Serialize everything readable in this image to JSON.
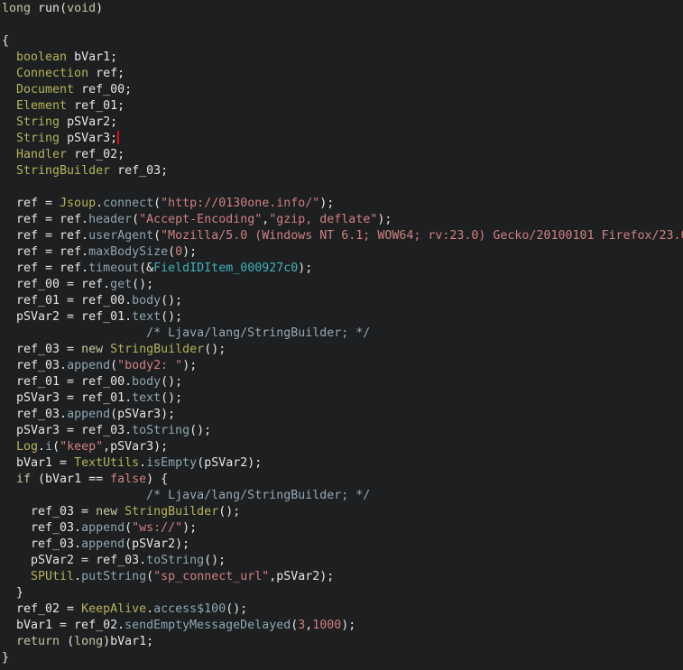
{
  "colors": {
    "background": "#1d1f21",
    "plain": "#e6e6e6",
    "keyword": "#c9c6a0",
    "type": "#b5b35a",
    "function": "#8fa6b2",
    "string": "#d08080",
    "number": "#d08080",
    "comment": "#98a8b6",
    "field": "#40b2b8",
    "caret": "#e0101a"
  },
  "editor": {
    "caret_line": 9,
    "lines": [
      [
        [
          "kw",
          "long "
        ],
        [
          "plain",
          "run"
        ],
        [
          "paren",
          "("
        ],
        [
          "kw",
          "void"
        ],
        [
          "paren",
          ")"
        ]
      ],
      [],
      [
        [
          "plain",
          "{"
        ]
      ],
      [
        [
          "plain",
          "  "
        ],
        [
          "type",
          "boolean"
        ],
        [
          "plain",
          " bVar1;"
        ]
      ],
      [
        [
          "plain",
          "  "
        ],
        [
          "type",
          "Connection"
        ],
        [
          "plain",
          " ref;"
        ]
      ],
      [
        [
          "plain",
          "  "
        ],
        [
          "type",
          "Document"
        ],
        [
          "plain",
          " ref_00;"
        ]
      ],
      [
        [
          "plain",
          "  "
        ],
        [
          "type",
          "Element"
        ],
        [
          "plain",
          " ref_01;"
        ]
      ],
      [
        [
          "plain",
          "  "
        ],
        [
          "type",
          "String"
        ],
        [
          "plain",
          " pSVar2;"
        ]
      ],
      [
        [
          "plain",
          "  "
        ],
        [
          "type",
          "String"
        ],
        [
          "plain",
          " pSVar3;"
        ]
      ],
      [
        [
          "plain",
          "  "
        ],
        [
          "type",
          "Handler"
        ],
        [
          "plain",
          " ref_02;"
        ]
      ],
      [
        [
          "plain",
          "  "
        ],
        [
          "type",
          "StringBuilder"
        ],
        [
          "plain",
          " ref_03;"
        ]
      ],
      [],
      [
        [
          "plain",
          "  ref = "
        ],
        [
          "type",
          "Jsoup"
        ],
        [
          "plain",
          "."
        ],
        [
          "fn",
          "connect"
        ],
        [
          "plain",
          "("
        ],
        [
          "str",
          "\"http://0130one.info/\""
        ],
        [
          "plain",
          ");"
        ]
      ],
      [
        [
          "plain",
          "  ref = ref."
        ],
        [
          "fn",
          "header"
        ],
        [
          "plain",
          "("
        ],
        [
          "str",
          "\"Accept-Encoding\""
        ],
        [
          "plain",
          ","
        ],
        [
          "str",
          "\"gzip, deflate\""
        ],
        [
          "plain",
          ");"
        ]
      ],
      [
        [
          "plain",
          "  ref = ref."
        ],
        [
          "fn",
          "userAgent"
        ],
        [
          "plain",
          "("
        ],
        [
          "str",
          "\"Mozilla/5.0 (Windows NT 6.1; WOW64; rv:23.0) Gecko/20100101 Firefox/23.0\""
        ],
        [
          "plain",
          ");"
        ]
      ],
      [
        [
          "plain",
          "  ref = ref."
        ],
        [
          "fn",
          "maxBodySize"
        ],
        [
          "plain",
          "("
        ],
        [
          "num",
          "0"
        ],
        [
          "plain",
          ");"
        ]
      ],
      [
        [
          "plain",
          "  ref = ref."
        ],
        [
          "fn",
          "timeout"
        ],
        [
          "plain",
          "(&"
        ],
        [
          "field",
          "FieldIDItem_000927c0"
        ],
        [
          "plain",
          ");"
        ]
      ],
      [
        [
          "plain",
          "  ref_00 = ref."
        ],
        [
          "fn",
          "get"
        ],
        [
          "plain",
          "();"
        ]
      ],
      [
        [
          "plain",
          "  ref_01 = ref_00."
        ],
        [
          "fn",
          "body"
        ],
        [
          "plain",
          "();"
        ]
      ],
      [
        [
          "plain",
          "  pSVar2 = ref_01."
        ],
        [
          "fn",
          "text"
        ],
        [
          "plain",
          "();"
        ]
      ],
      [
        [
          "plain",
          "                    "
        ],
        [
          "comment",
          "/* Ljava/lang/StringBuilder; */"
        ]
      ],
      [
        [
          "plain",
          "  ref_03 = "
        ],
        [
          "kw",
          "new"
        ],
        [
          "plain",
          " "
        ],
        [
          "type",
          "StringBuilder"
        ],
        [
          "plain",
          "();"
        ]
      ],
      [
        [
          "plain",
          "  ref_03."
        ],
        [
          "fn",
          "append"
        ],
        [
          "plain",
          "("
        ],
        [
          "str",
          "\"body2: \""
        ],
        [
          "plain",
          ");"
        ]
      ],
      [
        [
          "plain",
          "  ref_01 = ref_00."
        ],
        [
          "fn",
          "body"
        ],
        [
          "plain",
          "();"
        ]
      ],
      [
        [
          "plain",
          "  pSVar3 = ref_01."
        ],
        [
          "fn",
          "text"
        ],
        [
          "plain",
          "();"
        ]
      ],
      [
        [
          "plain",
          "  ref_03."
        ],
        [
          "fn",
          "append"
        ],
        [
          "plain",
          "(pSVar3);"
        ]
      ],
      [
        [
          "plain",
          "  pSVar3 = ref_03."
        ],
        [
          "fn",
          "toString"
        ],
        [
          "plain",
          "();"
        ]
      ],
      [
        [
          "plain",
          "  "
        ],
        [
          "type",
          "Log"
        ],
        [
          "plain",
          "."
        ],
        [
          "fn",
          "i"
        ],
        [
          "plain",
          "("
        ],
        [
          "str",
          "\"keep\""
        ],
        [
          "plain",
          ",pSVar3);"
        ]
      ],
      [
        [
          "plain",
          "  bVar1 = "
        ],
        [
          "type",
          "TextUtils"
        ],
        [
          "plain",
          "."
        ],
        [
          "fn",
          "isEmpty"
        ],
        [
          "plain",
          "(pSVar2);"
        ]
      ],
      [
        [
          "plain",
          "  "
        ],
        [
          "kw",
          "if"
        ],
        [
          "plain",
          " (bVar1 == "
        ],
        [
          "num",
          "false"
        ],
        [
          "plain",
          ") {"
        ]
      ],
      [
        [
          "plain",
          "                    "
        ],
        [
          "comment",
          "/* Ljava/lang/StringBuilder; */"
        ]
      ],
      [
        [
          "plain",
          "    ref_03 = "
        ],
        [
          "kw",
          "new"
        ],
        [
          "plain",
          " "
        ],
        [
          "type",
          "StringBuilder"
        ],
        [
          "plain",
          "();"
        ]
      ],
      [
        [
          "plain",
          "    ref_03."
        ],
        [
          "fn",
          "append"
        ],
        [
          "plain",
          "("
        ],
        [
          "str",
          "\"ws://\""
        ],
        [
          "plain",
          ");"
        ]
      ],
      [
        [
          "plain",
          "    ref_03."
        ],
        [
          "fn",
          "append"
        ],
        [
          "plain",
          "(pSVar2);"
        ]
      ],
      [
        [
          "plain",
          "    pSVar2 = ref_03."
        ],
        [
          "fn",
          "toString"
        ],
        [
          "plain",
          "();"
        ]
      ],
      [
        [
          "plain",
          "    "
        ],
        [
          "type",
          "SPUtil"
        ],
        [
          "plain",
          "."
        ],
        [
          "fn",
          "putString"
        ],
        [
          "plain",
          "("
        ],
        [
          "str",
          "\"sp_connect_url\""
        ],
        [
          "plain",
          ",pSVar2);"
        ]
      ],
      [
        [
          "plain",
          "  }"
        ]
      ],
      [
        [
          "plain",
          "  ref_02 = "
        ],
        [
          "type",
          "KeepAlive"
        ],
        [
          "plain",
          "."
        ],
        [
          "fn",
          "access$100"
        ],
        [
          "plain",
          "();"
        ]
      ],
      [
        [
          "plain",
          "  bVar1 = ref_02."
        ],
        [
          "fn",
          "sendEmptyMessageDelayed"
        ],
        [
          "plain",
          "("
        ],
        [
          "num",
          "3"
        ],
        [
          "plain",
          ","
        ],
        [
          "num",
          "1000"
        ],
        [
          "plain",
          ");"
        ]
      ],
      [
        [
          "plain",
          "  "
        ],
        [
          "kw",
          "return"
        ],
        [
          "plain",
          " ("
        ],
        [
          "kw",
          "long"
        ],
        [
          "plain",
          ")bVar1;"
        ]
      ],
      [
        [
          "plain",
          "}"
        ]
      ]
    ]
  }
}
